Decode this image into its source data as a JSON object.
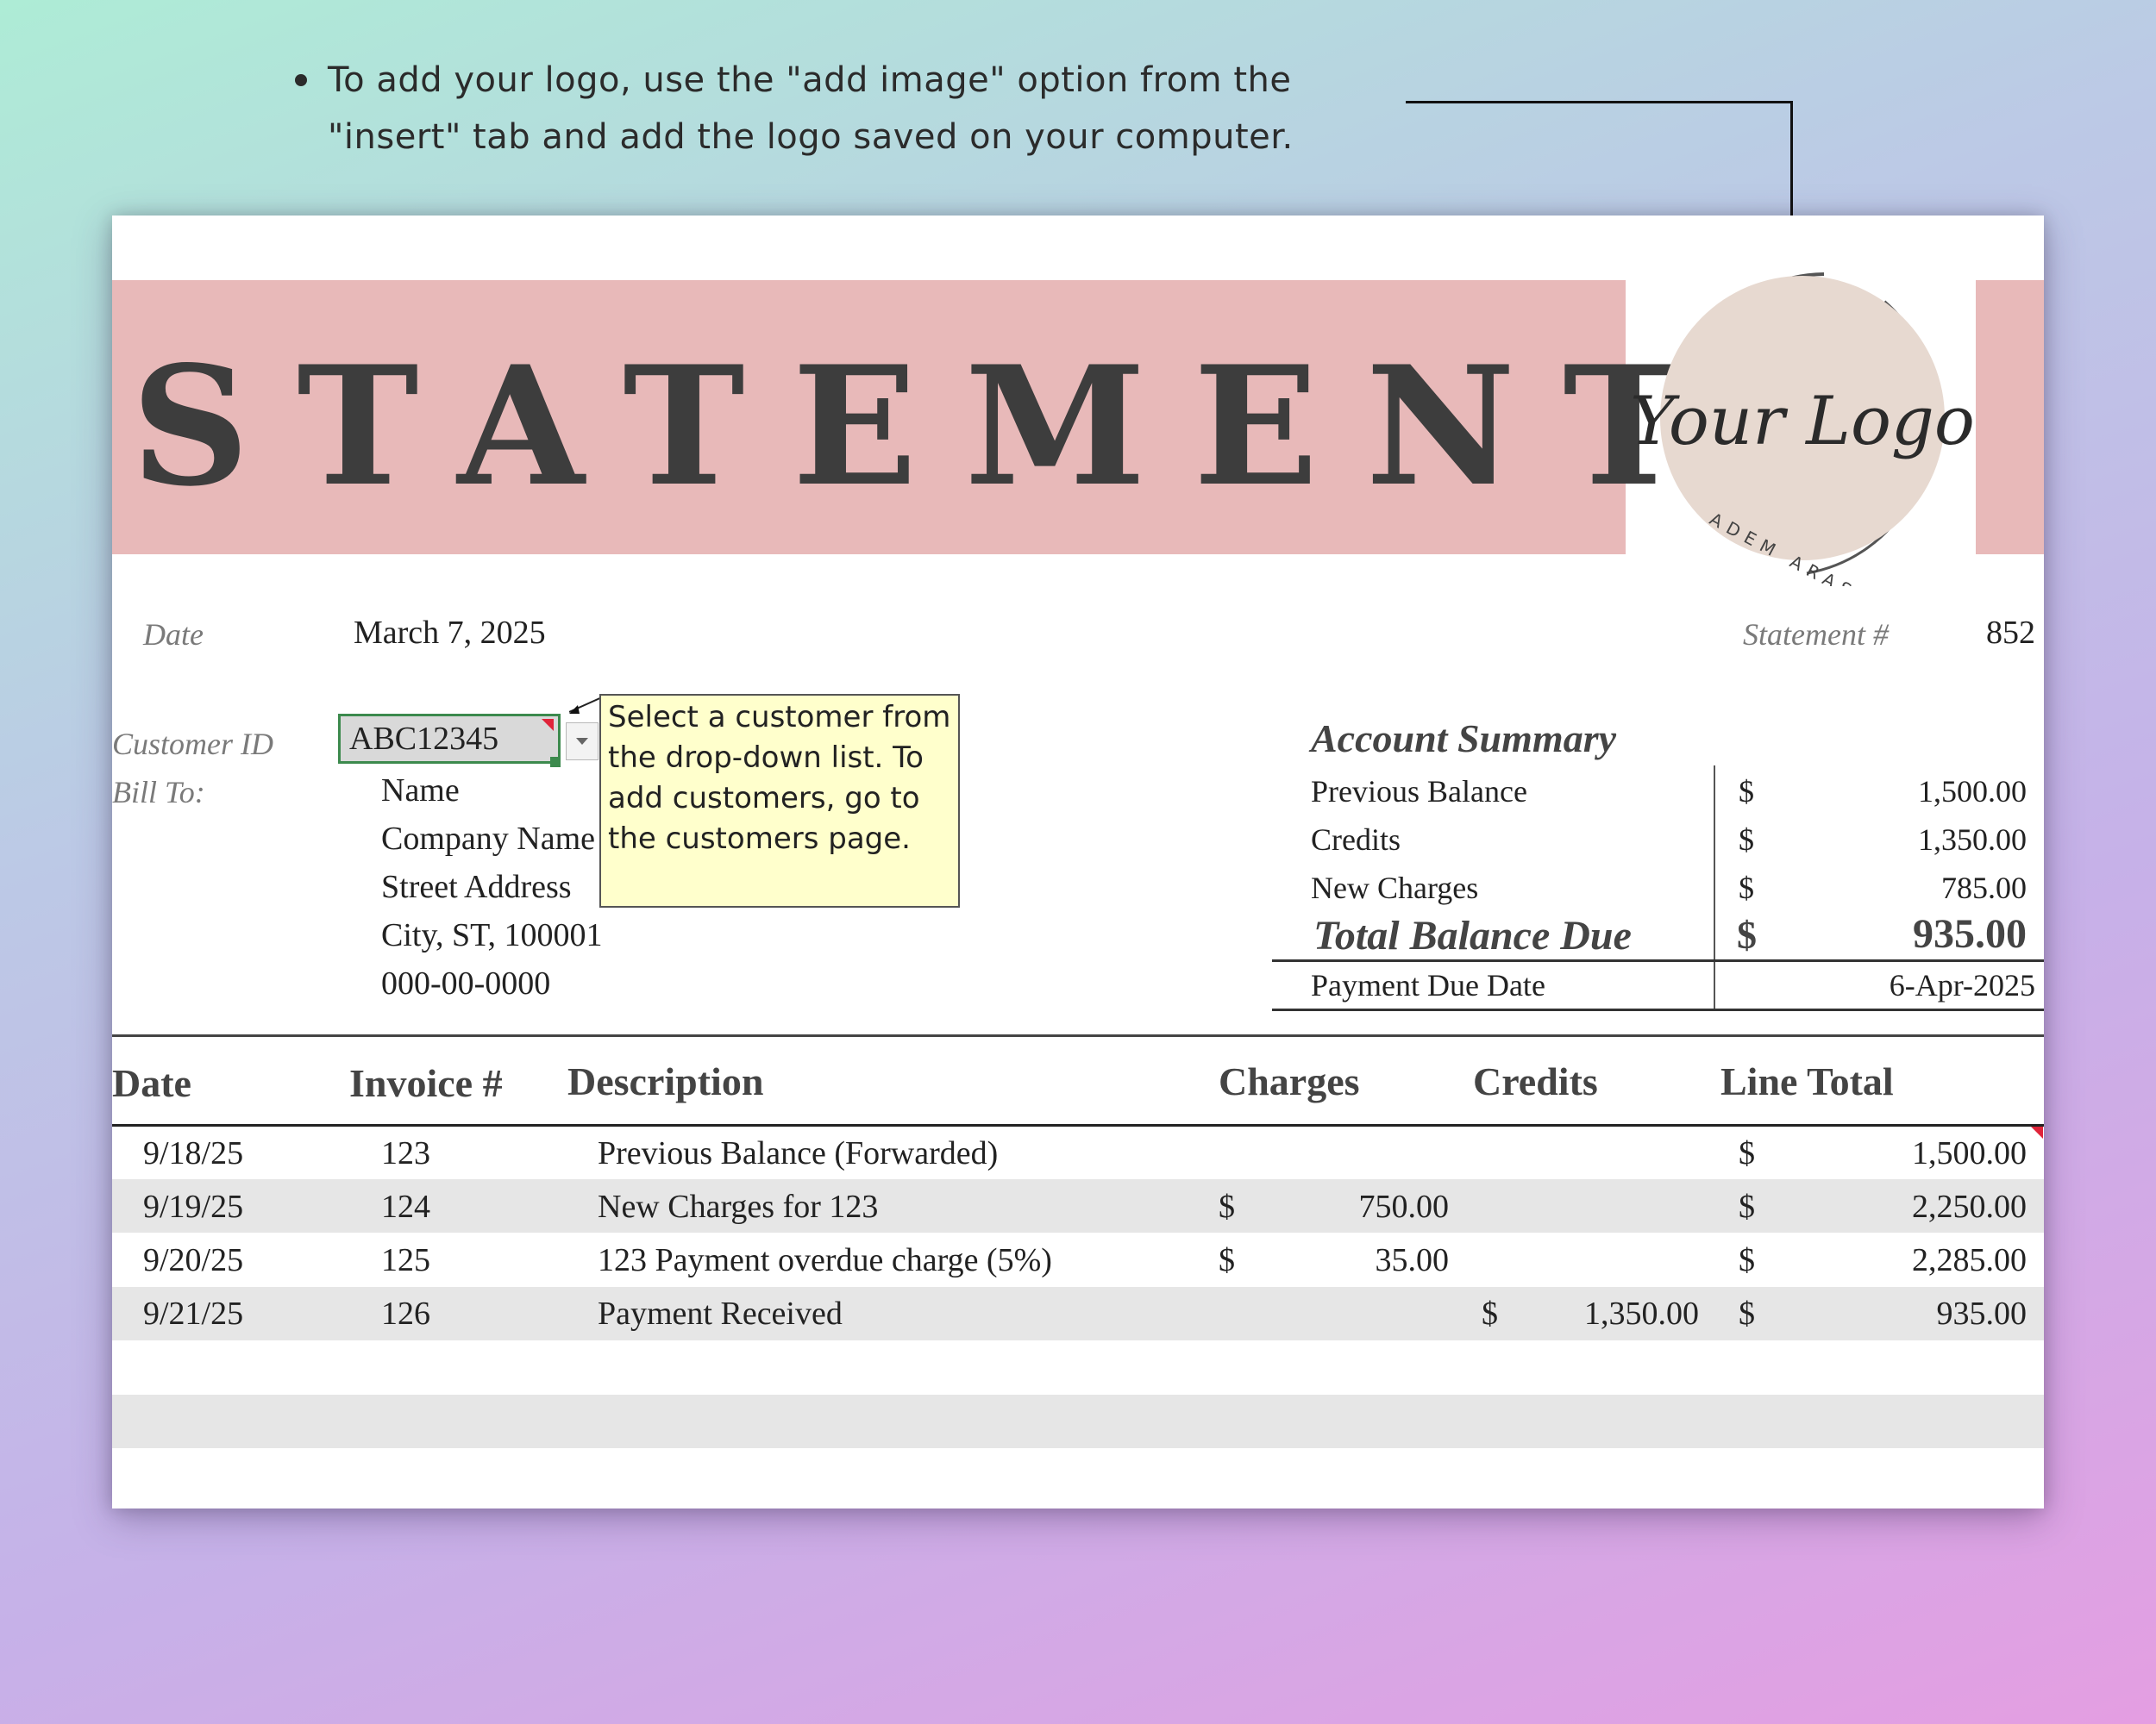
{
  "note": {
    "text": "To add your logo, use the \"add image\" option from the \"insert\" tab and add the logo saved on your computer."
  },
  "banner": {
    "title": "STATEMENT"
  },
  "logo": {
    "script_text": "Your Logo",
    "ring_text": "ADEM ARAS"
  },
  "header": {
    "date_label": "Date",
    "date_value": "March 7, 2025",
    "statement_label": "Statement #",
    "statement_value": "852"
  },
  "customer": {
    "id_label": "Customer ID",
    "id_value": "ABC12345",
    "bill_to_label": "Bill To:",
    "bill_to_lines": [
      "Name",
      "Company Name",
      "Street Address",
      "City, ST, 100001",
      "000-00-0000"
    ]
  },
  "tooltip": {
    "text": "Select a customer from the drop-down list. To add customers, go to the customers page."
  },
  "summary": {
    "title": "Account Summary",
    "rows": [
      {
        "label": "Previous Balance",
        "currency": "$",
        "value": "1,500.00"
      },
      {
        "label": "Credits",
        "currency": "$",
        "value": "1,350.00"
      },
      {
        "label": "New Charges",
        "currency": "$",
        "value": "785.00"
      }
    ],
    "total_label": "Total Balance Due",
    "total_currency": "$",
    "total_value": "935.00",
    "due_label": "Payment Due Date",
    "due_value": "6-Apr-2025"
  },
  "table": {
    "headers": [
      "Date",
      "Invoice #",
      "Description",
      "Charges",
      "Credits",
      "Line Total"
    ],
    "rows": [
      {
        "date": "9/18/25",
        "invoice": "123",
        "description": "Previous Balance (Forwarded)",
        "charges_cur": "",
        "charges": "",
        "credits_cur": "",
        "credits": "",
        "total_cur": "$",
        "total": "1,500.00"
      },
      {
        "date": "9/19/25",
        "invoice": "124",
        "description": "New Charges for 123",
        "charges_cur": "$",
        "charges": "750.00",
        "credits_cur": "",
        "credits": "",
        "total_cur": "$",
        "total": "2,250.00"
      },
      {
        "date": "9/20/25",
        "invoice": "125",
        "description": "123 Payment overdue charge (5%)",
        "charges_cur": "$",
        "charges": "35.00",
        "credits_cur": "",
        "credits": "",
        "total_cur": "$",
        "total": "2,285.00"
      },
      {
        "date": "9/21/25",
        "invoice": "126",
        "description": "Payment Received",
        "charges_cur": "",
        "charges": "",
        "credits_cur": "$",
        "credits": "1,350.00",
        "total_cur": "$",
        "total": "935.00"
      }
    ]
  },
  "colors": {
    "banner": "#e8b9b9",
    "logo_circle": "#e7d9d0",
    "band": "#e6e6e6",
    "tooltip": "#ffffcc",
    "selection": "#3c8a4d"
  }
}
